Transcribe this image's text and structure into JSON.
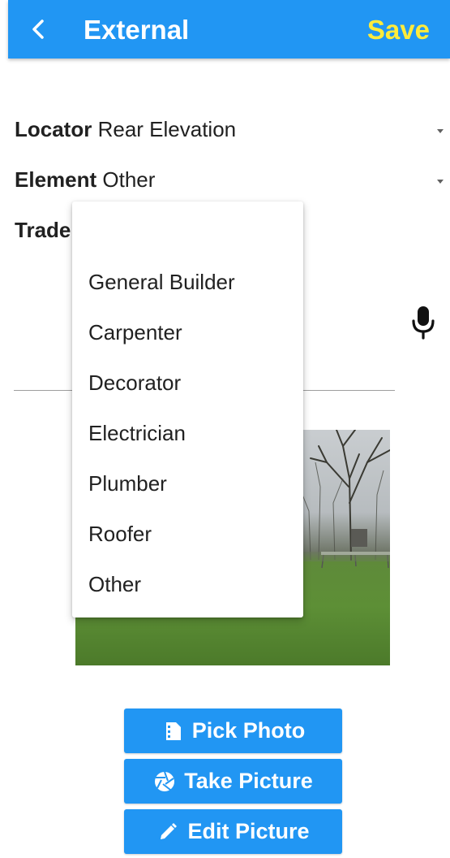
{
  "app_bar": {
    "back_icon": "chevron-left-icon",
    "title": "External",
    "save_label": "Save",
    "colors": {
      "bar": "#2196f3",
      "save": "#ffeb3b",
      "title": "#ffffff"
    }
  },
  "form": {
    "locator": {
      "label": "Locator",
      "value": "Rear Elevation"
    },
    "element": {
      "label": "Element",
      "value": "Other"
    },
    "trade": {
      "label": "Trade"
    },
    "mic_icon": "microphone-icon"
  },
  "trade_menu": {
    "options": [
      "General Builder",
      "Carpenter",
      "Decorator",
      "Electrician",
      "Plumber",
      "Roofer",
      "Other"
    ]
  },
  "buttons": {
    "pick_photo": {
      "label": "Pick Photo",
      "icon": "film-icon"
    },
    "take_picture": {
      "label": "Take Picture",
      "icon": "camera-shutter-icon"
    },
    "edit_picture": {
      "label": "Edit Picture",
      "icon": "pencil-icon"
    }
  }
}
